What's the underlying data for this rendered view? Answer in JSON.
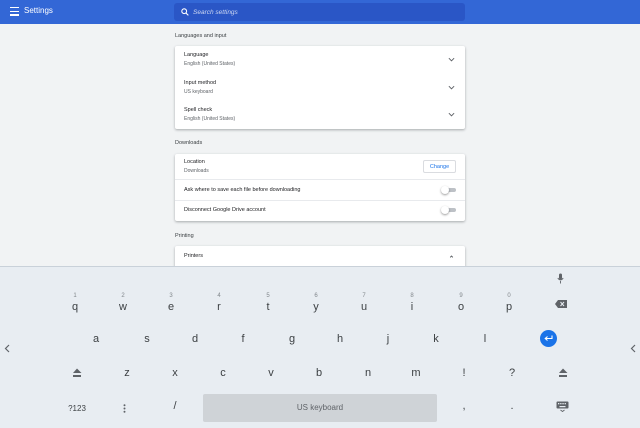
{
  "header": {
    "title": "Settings",
    "search_placeholder": "Search settings"
  },
  "sections": {
    "languages": {
      "title": "Languages and input",
      "rows": [
        {
          "label": "Language",
          "value": "English (United States)"
        },
        {
          "label": "Input method",
          "value": "US keyboard"
        },
        {
          "label": "Spell check",
          "value": "English (United States)"
        }
      ]
    },
    "downloads": {
      "title": "Downloads",
      "location_label": "Location",
      "location_value": "Downloads",
      "change_label": "Change",
      "ask_label": "Ask where to save each file before downloading",
      "disconnect_label": "Disconnect Google Drive account"
    },
    "printing": {
      "title": "Printing",
      "printers_label": "Printers"
    }
  },
  "keyboard": {
    "row1": [
      {
        "hint": "1",
        "ch": "q"
      },
      {
        "hint": "2",
        "ch": "w"
      },
      {
        "hint": "3",
        "ch": "e"
      },
      {
        "hint": "4",
        "ch": "r"
      },
      {
        "hint": "5",
        "ch": "t"
      },
      {
        "hint": "6",
        "ch": "y"
      },
      {
        "hint": "7",
        "ch": "u"
      },
      {
        "hint": "8",
        "ch": "i"
      },
      {
        "hint": "9",
        "ch": "o"
      },
      {
        "hint": "0",
        "ch": "p"
      }
    ],
    "row2": [
      "a",
      "s",
      "d",
      "f",
      "g",
      "h",
      "j",
      "k",
      "l"
    ],
    "row3": [
      "z",
      "x",
      "c",
      "v",
      "b",
      "n",
      "m",
      "!",
      "?"
    ],
    "numbers_key": "?123",
    "slash_key": "/",
    "comma_key": ",",
    "period_key": ".",
    "space_label": "US keyboard"
  },
  "colors": {
    "header": "#3367d6",
    "accent": "#1a73e8",
    "keyboard_bg": "#e8edf2"
  }
}
